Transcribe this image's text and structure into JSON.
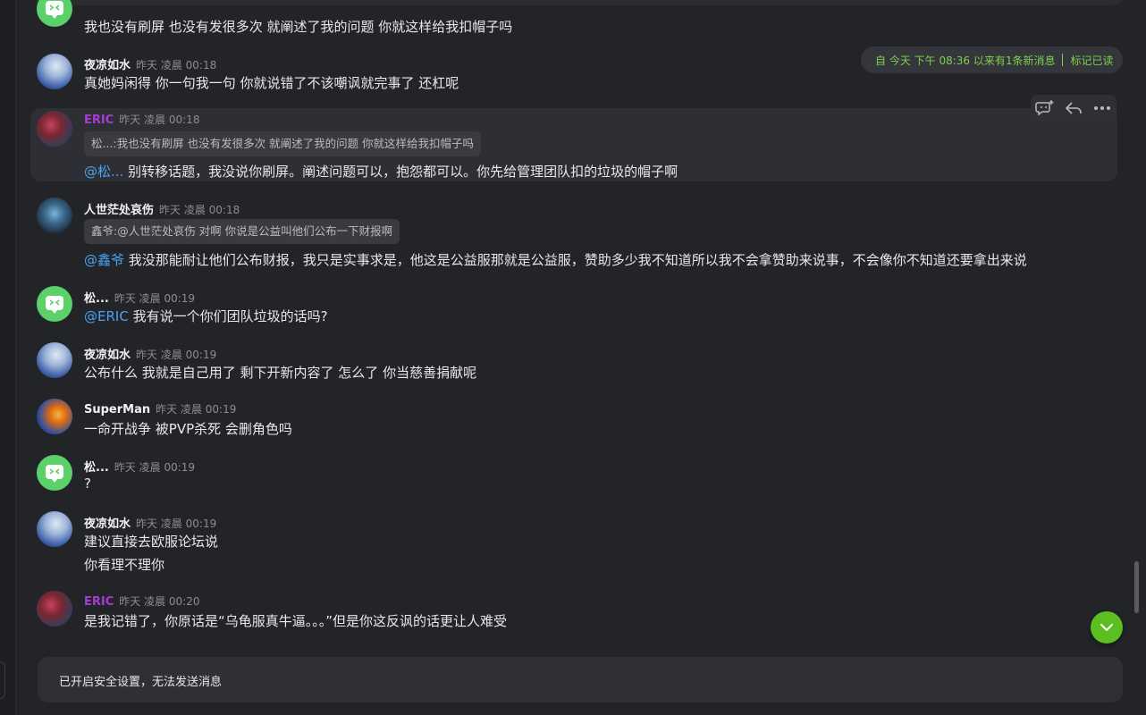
{
  "banner": {
    "new_messages": "自 今天 下午 08:36 以来有1条新消息",
    "mark_read": "标记已读"
  },
  "messages": [
    {
      "text": "我也没有刷屏 也没有发很多次 就阐述了我的问题 你就这样给我扣帽子吗"
    },
    {
      "name": "夜凉如水",
      "time": "昨天 凌晨 00:18",
      "text": "真她妈闲得 你一句我一句 你就说错了不该嘲讽就完事了 还杠呢"
    },
    {
      "name": "ERIC",
      "time": "昨天 凌晨 00:18",
      "quote": "松...:我也没有刷屏 也没有发很多次 就阐述了我的问题 你就这样给我扣帽子吗",
      "mention": "@松...",
      "text": " 别转移话题，我没说你刷屏。阐述问题可以，抱怨都可以。你先给管理团队扣的垃圾的帽子啊"
    },
    {
      "name": "人世茫处哀伤",
      "time": "昨天 凌晨 00:18",
      "quote": "鑫爷:@人世茫处哀伤 对啊  你说是公益叫他们公布一下财报啊",
      "mention": "@鑫爷",
      "text": " 我没那能耐让他们公布财报，我只是实事求是，他这是公益服那就是公益服，赞助多少我不知道所以我不会拿赞助来说事，不会像你不知道还要拿出来说"
    },
    {
      "name": "松...",
      "time": "昨天 凌晨 00:19",
      "mention": "@ERIC",
      "text": " 我有说一个你们团队垃圾的话吗?"
    },
    {
      "name": "夜凉如水",
      "time": "昨天 凌晨 00:19",
      "text": "公布什么 我就是自己用了 剩下开新内容了 怎么了 你当慈善捐献呢"
    },
    {
      "name": "SuperMan",
      "time": "昨天 凌晨 00:19",
      "text": "一命开战争 被PVP杀死 会删角色吗"
    },
    {
      "name": "松...",
      "time": "昨天 凌晨 00:19",
      "text": "?"
    },
    {
      "name": "夜凉如水",
      "time": "昨天 凌晨 00:19",
      "text": "建议直接去欧服论坛说",
      "text2": "你看理不理你"
    },
    {
      "name": "ERIC",
      "time": "昨天 凌晨 00:20",
      "text": "是我记错了，你原话是“乌龟服真牛逼。。。”但是你这反讽的话更让人难受"
    }
  ],
  "input": {
    "disabled_text": "已开启安全设置，无法发送消息"
  },
  "colors": {
    "accent": "#5bbf21",
    "banner_text": "#7cd14a",
    "mention": "#4aa3f2",
    "eric_name": "#a73cd4"
  },
  "icons": {
    "sticker": "sticker-add-icon",
    "reply": "reply-icon",
    "more": "more-icon",
    "scroll": "chevron-down-icon"
  }
}
